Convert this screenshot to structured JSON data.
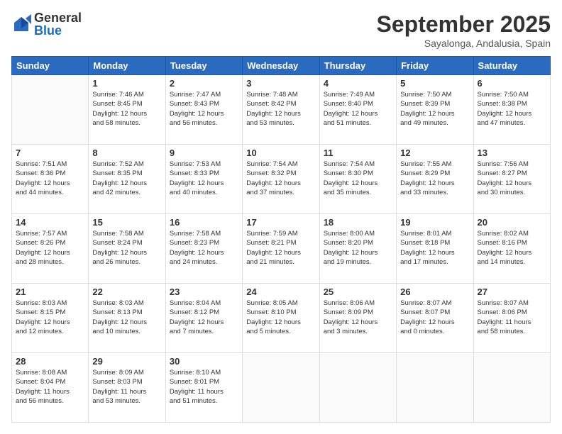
{
  "logo": {
    "general": "General",
    "blue": "Blue"
  },
  "title": "September 2025",
  "location": "Sayalonga, Andalusia, Spain",
  "days_of_week": [
    "Sunday",
    "Monday",
    "Tuesday",
    "Wednesday",
    "Thursday",
    "Friday",
    "Saturday"
  ],
  "weeks": [
    [
      {
        "day": "",
        "info": ""
      },
      {
        "day": "1",
        "info": "Sunrise: 7:46 AM\nSunset: 8:45 PM\nDaylight: 12 hours\nand 58 minutes."
      },
      {
        "day": "2",
        "info": "Sunrise: 7:47 AM\nSunset: 8:43 PM\nDaylight: 12 hours\nand 56 minutes."
      },
      {
        "day": "3",
        "info": "Sunrise: 7:48 AM\nSunset: 8:42 PM\nDaylight: 12 hours\nand 53 minutes."
      },
      {
        "day": "4",
        "info": "Sunrise: 7:49 AM\nSunset: 8:40 PM\nDaylight: 12 hours\nand 51 minutes."
      },
      {
        "day": "5",
        "info": "Sunrise: 7:50 AM\nSunset: 8:39 PM\nDaylight: 12 hours\nand 49 minutes."
      },
      {
        "day": "6",
        "info": "Sunrise: 7:50 AM\nSunset: 8:38 PM\nDaylight: 12 hours\nand 47 minutes."
      }
    ],
    [
      {
        "day": "7",
        "info": "Sunrise: 7:51 AM\nSunset: 8:36 PM\nDaylight: 12 hours\nand 44 minutes."
      },
      {
        "day": "8",
        "info": "Sunrise: 7:52 AM\nSunset: 8:35 PM\nDaylight: 12 hours\nand 42 minutes."
      },
      {
        "day": "9",
        "info": "Sunrise: 7:53 AM\nSunset: 8:33 PM\nDaylight: 12 hours\nand 40 minutes."
      },
      {
        "day": "10",
        "info": "Sunrise: 7:54 AM\nSunset: 8:32 PM\nDaylight: 12 hours\nand 37 minutes."
      },
      {
        "day": "11",
        "info": "Sunrise: 7:54 AM\nSunset: 8:30 PM\nDaylight: 12 hours\nand 35 minutes."
      },
      {
        "day": "12",
        "info": "Sunrise: 7:55 AM\nSunset: 8:29 PM\nDaylight: 12 hours\nand 33 minutes."
      },
      {
        "day": "13",
        "info": "Sunrise: 7:56 AM\nSunset: 8:27 PM\nDaylight: 12 hours\nand 30 minutes."
      }
    ],
    [
      {
        "day": "14",
        "info": "Sunrise: 7:57 AM\nSunset: 8:26 PM\nDaylight: 12 hours\nand 28 minutes."
      },
      {
        "day": "15",
        "info": "Sunrise: 7:58 AM\nSunset: 8:24 PM\nDaylight: 12 hours\nand 26 minutes."
      },
      {
        "day": "16",
        "info": "Sunrise: 7:58 AM\nSunset: 8:23 PM\nDaylight: 12 hours\nand 24 minutes."
      },
      {
        "day": "17",
        "info": "Sunrise: 7:59 AM\nSunset: 8:21 PM\nDaylight: 12 hours\nand 21 minutes."
      },
      {
        "day": "18",
        "info": "Sunrise: 8:00 AM\nSunset: 8:20 PM\nDaylight: 12 hours\nand 19 minutes."
      },
      {
        "day": "19",
        "info": "Sunrise: 8:01 AM\nSunset: 8:18 PM\nDaylight: 12 hours\nand 17 minutes."
      },
      {
        "day": "20",
        "info": "Sunrise: 8:02 AM\nSunset: 8:16 PM\nDaylight: 12 hours\nand 14 minutes."
      }
    ],
    [
      {
        "day": "21",
        "info": "Sunrise: 8:03 AM\nSunset: 8:15 PM\nDaylight: 12 hours\nand 12 minutes."
      },
      {
        "day": "22",
        "info": "Sunrise: 8:03 AM\nSunset: 8:13 PM\nDaylight: 12 hours\nand 10 minutes."
      },
      {
        "day": "23",
        "info": "Sunrise: 8:04 AM\nSunset: 8:12 PM\nDaylight: 12 hours\nand 7 minutes."
      },
      {
        "day": "24",
        "info": "Sunrise: 8:05 AM\nSunset: 8:10 PM\nDaylight: 12 hours\nand 5 minutes."
      },
      {
        "day": "25",
        "info": "Sunrise: 8:06 AM\nSunset: 8:09 PM\nDaylight: 12 hours\nand 3 minutes."
      },
      {
        "day": "26",
        "info": "Sunrise: 8:07 AM\nSunset: 8:07 PM\nDaylight: 12 hours\nand 0 minutes."
      },
      {
        "day": "27",
        "info": "Sunrise: 8:07 AM\nSunset: 8:06 PM\nDaylight: 11 hours\nand 58 minutes."
      }
    ],
    [
      {
        "day": "28",
        "info": "Sunrise: 8:08 AM\nSunset: 8:04 PM\nDaylight: 11 hours\nand 56 minutes."
      },
      {
        "day": "29",
        "info": "Sunrise: 8:09 AM\nSunset: 8:03 PM\nDaylight: 11 hours\nand 53 minutes."
      },
      {
        "day": "30",
        "info": "Sunrise: 8:10 AM\nSunset: 8:01 PM\nDaylight: 11 hours\nand 51 minutes."
      },
      {
        "day": "",
        "info": ""
      },
      {
        "day": "",
        "info": ""
      },
      {
        "day": "",
        "info": ""
      },
      {
        "day": "",
        "info": ""
      }
    ]
  ]
}
